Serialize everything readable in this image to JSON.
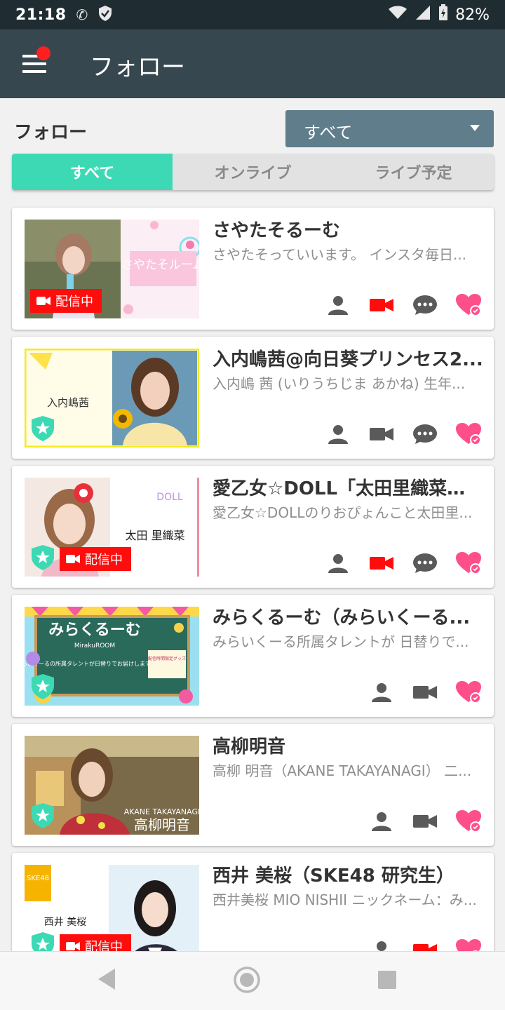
{
  "status_bar": {
    "time": "21:18",
    "battery": "82%"
  },
  "app_bar": {
    "title": "フォロー"
  },
  "filter": {
    "label": "フォロー",
    "dropdown_value": "すべて"
  },
  "tabs": [
    {
      "label": "すべて",
      "active": true
    },
    {
      "label": "オンライブ",
      "active": false
    },
    {
      "label": "ライブ予定",
      "active": false
    }
  ],
  "live_label": "配信中",
  "colors": {
    "accent": "#3dd9b4",
    "appbar": "#37474f",
    "live": "#ff0d0d",
    "heart": "#ff4f8b"
  },
  "cards": [
    {
      "name": "さやたそるーむ",
      "desc": "さやたそっていいます。 インスタ毎日...",
      "live": true,
      "official": false,
      "thumb_text": "さやたそルーム",
      "camera_active": true,
      "has_chat": true
    },
    {
      "name": "入内嶋茜@向日葵プリンセス2...",
      "desc": "入内嶋 茜 (いりうちじま あかね) 生年...",
      "live": false,
      "official": true,
      "thumb_text": "入内嶋茜",
      "camera_active": false,
      "has_chat": true
    },
    {
      "name": "愛乙女☆DOLL「太田里織菜の...",
      "desc": "愛乙女☆DOLLのりおぴょんこと太田里...",
      "live": true,
      "official": true,
      "thumb_text": "太田 里織菜",
      "thumb_logo": "DOLL",
      "camera_active": true,
      "has_chat": true
    },
    {
      "name": "みらくるーむ（みらいくーる...",
      "desc": "みらいくーる所属タレントが 日替りで...",
      "live": false,
      "official": true,
      "thumb_text": "みらくるーむ",
      "thumb_sub": "MirakuROOM",
      "thumb_note": "みらいくーるの所属タレントが日替りでお届けします！",
      "thumb_tag": "配信時間限定グッズ",
      "camera_active": false,
      "has_chat": false
    },
    {
      "name": "高柳明音",
      "desc": "高柳 明音（AKANE TAKAYANAGI） 二...",
      "live": false,
      "official": true,
      "thumb_text": "高柳明音",
      "thumb_sub": "AKANE TAKAYANAGI",
      "camera_active": false,
      "has_chat": false
    },
    {
      "name": "西井 美桜（SKE48 研究生）",
      "desc": "西井美桜 MIO NISHII ニックネーム：み...",
      "live": true,
      "official": true,
      "thumb_text": "西井 美桜",
      "thumb_logo": "SKE48",
      "camera_active": true,
      "has_chat": false
    }
  ]
}
